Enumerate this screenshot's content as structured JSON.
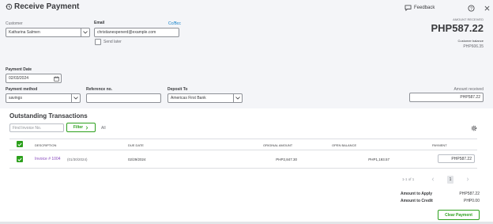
{
  "header": {
    "title": "Receive Payment",
    "feedback_label": "Feedback",
    "amount_received_label": "AMOUNT RECEIVED",
    "amount_received_value": "PHP587.22",
    "customer_balance_label": "Customer balance",
    "customer_balance_value": "PHP606.35"
  },
  "form": {
    "customer_label": "Customer",
    "customer_value": "Katharina Salmen",
    "email_label": "Email",
    "email_value": "christianespenerd@example.com",
    "ccbcc_label": "Cc/Bcc",
    "send_later_label": "Send later",
    "payment_date_label": "Payment Date",
    "payment_date_value": "02/03/2024",
    "payment_method_label": "Payment method",
    "payment_method_value": "savings",
    "reference_label": "Reference no.",
    "reference_value": "",
    "deposit_to_label": "Deposit To",
    "deposit_to_value": "Americas First Bank",
    "amount_received_label": "Amount received",
    "amount_received_value": "PHP587.22"
  },
  "outstanding": {
    "title": "Outstanding Transactions",
    "search_placeholder": "Find Invoice No.",
    "filter_label": "Filter",
    "all_label": "All",
    "columns": {
      "description": "DESCRIPTION",
      "due_date": "DUE DATE",
      "original_amount": "ORIGINAL AMOUNT",
      "open_balance": "OPEN BALANCE",
      "payment": "PAYMENT"
    },
    "rows": [
      {
        "invoice_link": "Invoice # 1004",
        "invoice_date": "(01/30/2024)",
        "due_date": "02/29/2024",
        "original_amount": "PHP2,847.30",
        "open_balance": "PHP1,193.57",
        "payment": "PHP587.22"
      }
    ],
    "pagination": {
      "range": "1-1 of 1",
      "current_page": "1"
    }
  },
  "totals": {
    "amount_to_apply_label": "Amount to Apply",
    "amount_to_apply_value": "PHP587.22",
    "amount_to_credit_label": "Amount to Credit",
    "amount_to_credit_value": "PHP0.00",
    "clear_payment_label": "Clear Payment"
  },
  "colors": {
    "accent_green": "#2ca01c",
    "link_purple": "#8c4fbf",
    "link_blue": "#0077c5"
  }
}
